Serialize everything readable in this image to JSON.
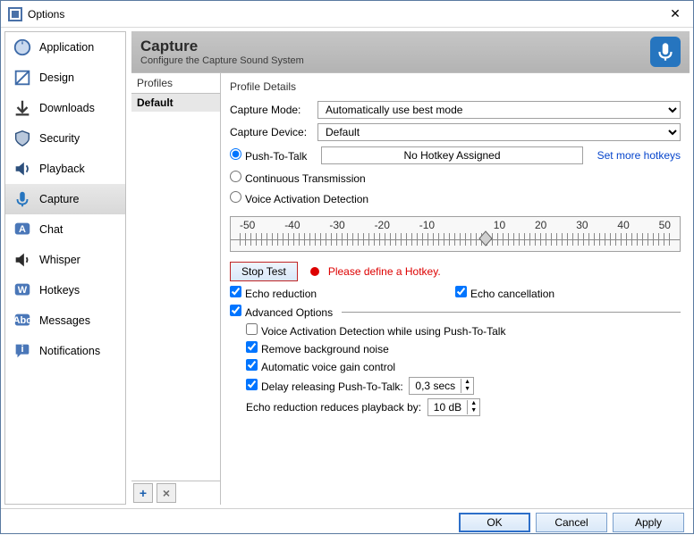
{
  "window": {
    "title": "Options"
  },
  "sidebar": {
    "items": [
      {
        "label": "Application"
      },
      {
        "label": "Design"
      },
      {
        "label": "Downloads"
      },
      {
        "label": "Security"
      },
      {
        "label": "Playback"
      },
      {
        "label": "Capture"
      },
      {
        "label": "Chat"
      },
      {
        "label": "Whisper"
      },
      {
        "label": "Hotkeys"
      },
      {
        "label": "Messages"
      },
      {
        "label": "Notifications"
      }
    ]
  },
  "header": {
    "title": "Capture",
    "subtitle": "Configure the Capture Sound System"
  },
  "profiles": {
    "heading": "Profiles",
    "items": [
      "Default"
    ],
    "add": "+",
    "remove": "×"
  },
  "details": {
    "heading": "Profile Details",
    "captureModeLabel": "Capture Mode:",
    "captureModeValue": "Automatically use best mode",
    "captureDeviceLabel": "Capture Device:",
    "captureDeviceValue": "Default",
    "ptt": "Push-To-Talk",
    "pttHotkey": "No Hotkey Assigned",
    "moreHotkeys": "Set more hotkeys",
    "continuous": "Continuous Transmission",
    "vad": "Voice Activation Detection",
    "rulerTicks": [
      "-50",
      "-40",
      "-30",
      "-20",
      "-10",
      "",
      "10",
      "20",
      "30",
      "40",
      "50"
    ],
    "stopTest": "Stop Test",
    "warn": "Please define a Hotkey.",
    "echoReduction": "Echo reduction",
    "echoCancel": "Echo cancellation",
    "advHeading": "Advanced Options",
    "vadPtt": "Voice Activation Detection while using Push-To-Talk",
    "removeNoise": "Remove background noise",
    "autoGain": "Automatic voice gain control",
    "delayLabel": "Delay releasing Push-To-Talk:",
    "delayValue": "0,3 secs",
    "echoReduceLabel": "Echo reduction reduces playback by:",
    "echoReduceValue": "10 dB"
  },
  "footer": {
    "ok": "OK",
    "cancel": "Cancel",
    "apply": "Apply"
  }
}
